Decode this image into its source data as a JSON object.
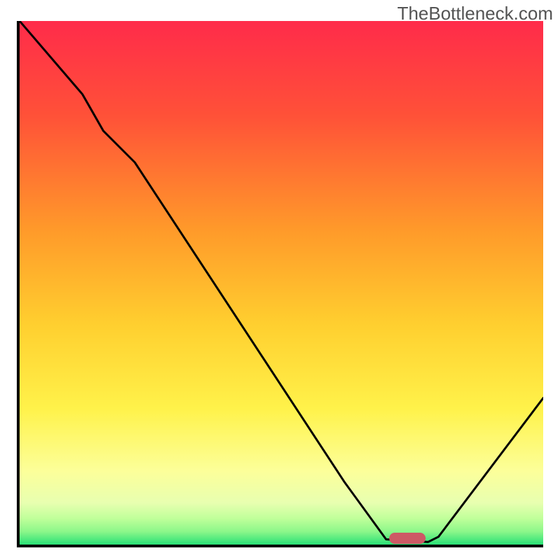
{
  "watermark": "TheBottleneck.com",
  "chart_data": {
    "type": "line",
    "title": "",
    "xlabel": "",
    "ylabel": "",
    "xlim": [
      0,
      100
    ],
    "ylim": [
      0,
      100
    ],
    "gradient_colors_top_to_bottom": [
      "#ff2b4a",
      "#ff8d2a",
      "#ffd633",
      "#fff85a",
      "#fdffb4",
      "#d6ff92",
      "#9aff7d",
      "#29e076"
    ],
    "series": [
      {
        "name": "bottleneck-curve",
        "x": [
          0,
          12,
          16,
          22,
          62,
          70,
          78,
          80,
          100
        ],
        "y": [
          100,
          86,
          79,
          73,
          12,
          1,
          0.5,
          1.5,
          28
        ]
      }
    ],
    "annotations": [
      {
        "name": "optimal-marker",
        "shape": "rounded-bar",
        "color": "#cd5965",
        "x": 74,
        "y": 1.2
      }
    ]
  }
}
